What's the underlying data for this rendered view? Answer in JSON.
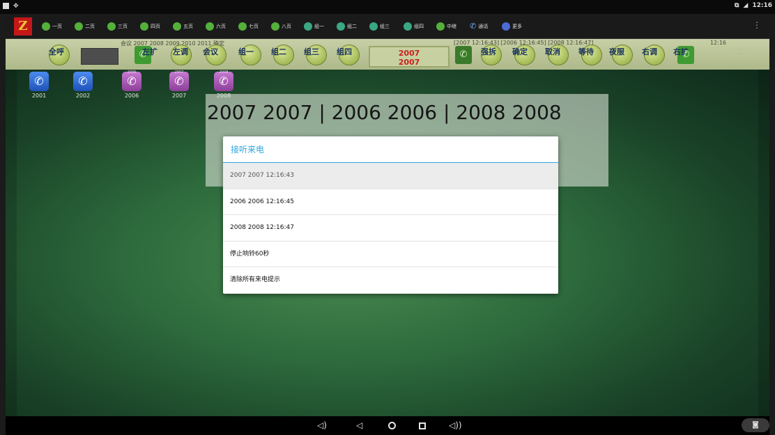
{
  "status_bar": {
    "time": "12:16"
  },
  "tabs": [
    {
      "label": "一页",
      "icon": "phone-dot-icon"
    },
    {
      "label": "二页",
      "icon": "phone-dot-icon"
    },
    {
      "label": "三页",
      "icon": "phone-dot-icon"
    },
    {
      "label": "四页",
      "icon": "phone-dot-icon"
    },
    {
      "label": "五页",
      "icon": "phone-dot-icon"
    },
    {
      "label": "六页",
      "icon": "phone-dot-icon"
    },
    {
      "label": "七页",
      "icon": "phone-dot-icon"
    },
    {
      "label": "八页",
      "icon": "phone-dot-icon"
    },
    {
      "label": "组一",
      "icon": "group-dot-icon"
    },
    {
      "label": "组二",
      "icon": "group-dot-icon"
    },
    {
      "label": "组三",
      "icon": "group-dot-icon"
    },
    {
      "label": "组四",
      "icon": "group-dot-icon"
    },
    {
      "label": "中继",
      "icon": "phone-dot-icon"
    },
    {
      "label": "通话",
      "icon": "handset-icon"
    },
    {
      "label": "更多",
      "icon": "gear-icon"
    }
  ],
  "control_bar": {
    "conference_info": "会议 2007 2008 2009 2010 2011 确定",
    "incoming_info": "[2007 12:16:43] [2006 12:16:45] [2008 12:16:47]",
    "clock": "12:16",
    "buttons": {
      "all_call": "全呼",
      "left_expand": "左扩",
      "left_adjust": "左调",
      "conference": "会议",
      "group1": "组一",
      "group2": "组二",
      "group3": "组三",
      "group4": "组四",
      "force_break": "强拆",
      "confirm": "确定",
      "cancel": "取消",
      "wait": "等待",
      "night": "夜服",
      "right_adjust": "右调",
      "right_expand": "右扩"
    },
    "selected_line1": "2007",
    "selected_line2": "2007"
  },
  "extensions": [
    {
      "number": "2001",
      "color": "blue"
    },
    {
      "number": "2002",
      "color": "blue"
    },
    {
      "number": "2006",
      "color": "purple",
      "tag": "2006"
    },
    {
      "number": "2007",
      "color": "purple",
      "tag": "2007"
    },
    {
      "number": "2008",
      "color": "purple",
      "tag": "2008"
    }
  ],
  "banner_text": "2007 2007 | 2006 2006 | 2008 2008",
  "dialog": {
    "title": "接听来电",
    "items": [
      "2007 2007 12:16:43",
      "2006 2006 12:16:45",
      "2008 2008 12:16:47",
      "停止响铃60秒",
      "清除所有来电提示"
    ]
  },
  "colors": {
    "dialog_accent": "#2ea7e0",
    "selected_text": "#cc2020",
    "desktop_green": "#2d6a3c"
  }
}
